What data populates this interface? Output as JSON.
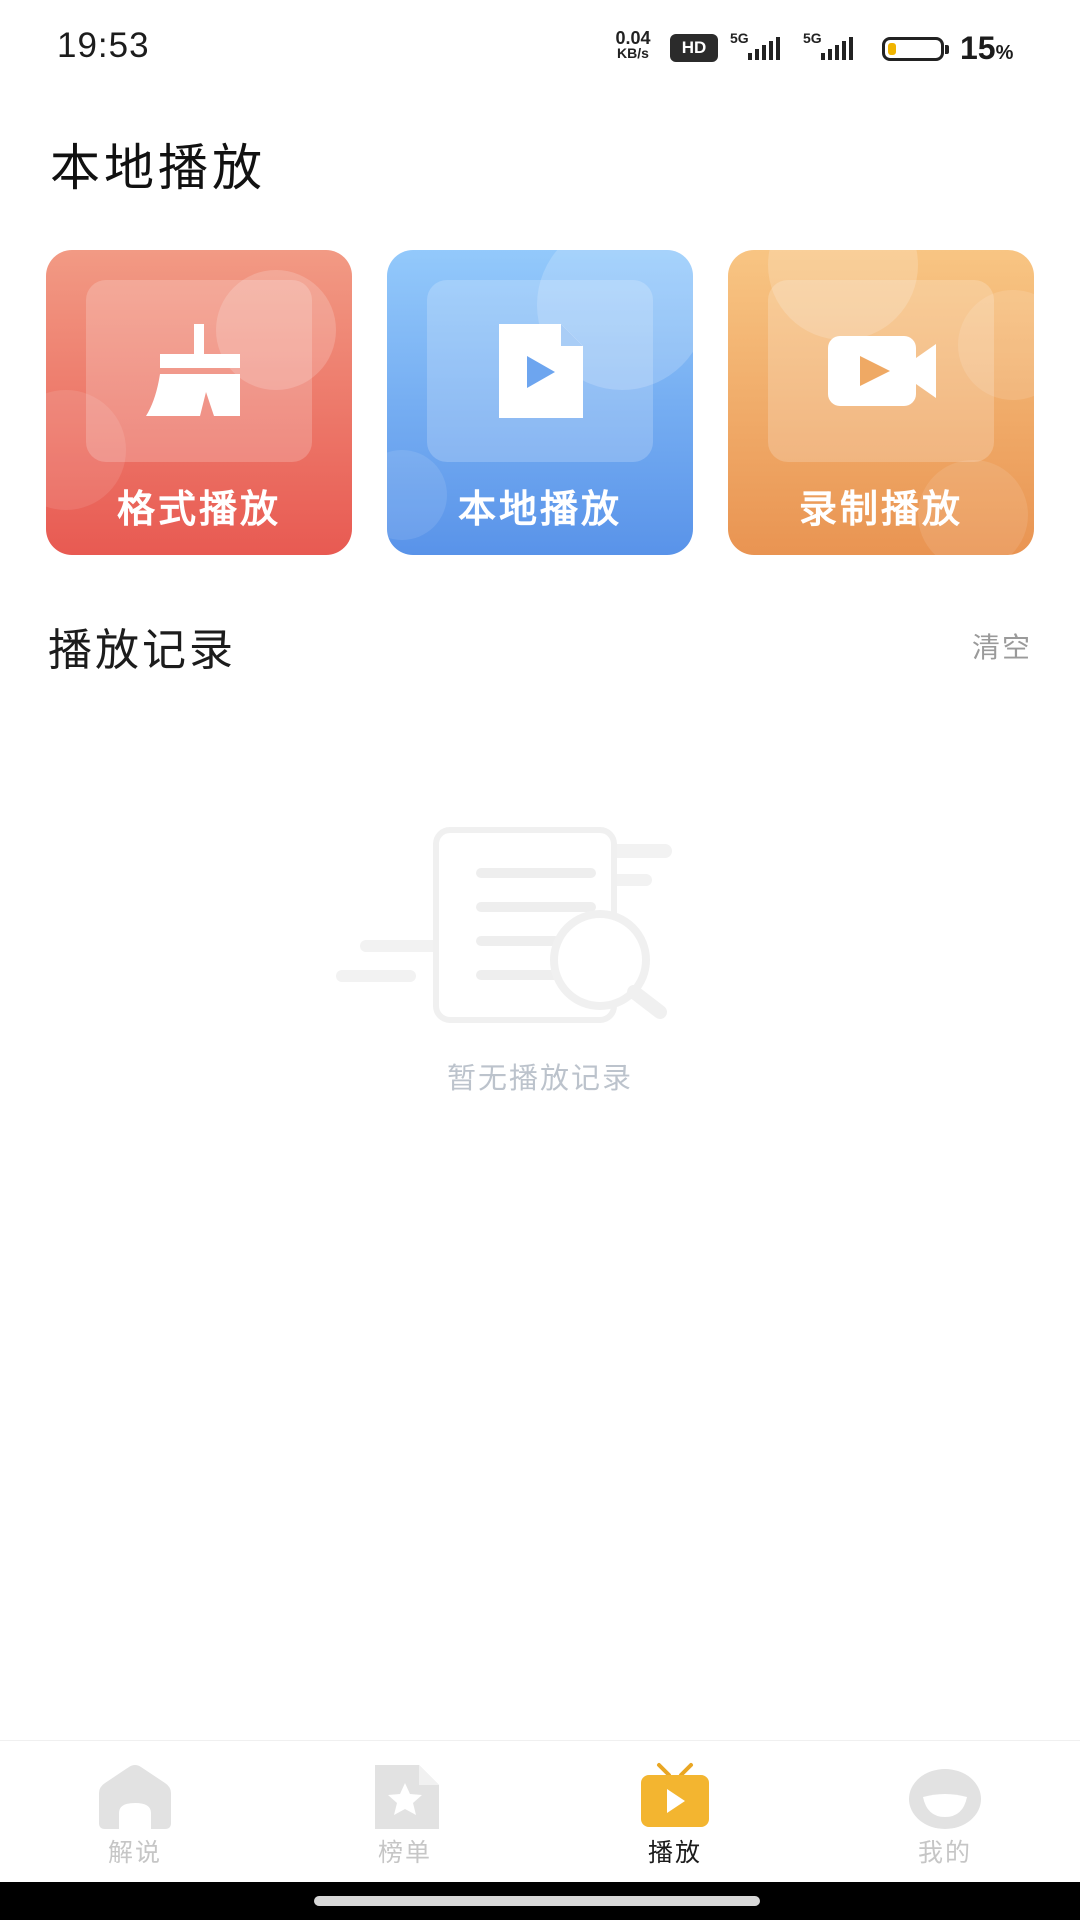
{
  "status_bar": {
    "time": "19:53",
    "net_speed_value": "0.04",
    "net_speed_unit": "KB/s",
    "hd_label": "HD",
    "signal_1_label": "5G",
    "signal_2_label": "5G",
    "battery_percent": "15",
    "battery_percent_sign": "%",
    "battery_level": 0.15,
    "battery_color": "#f0b400"
  },
  "page_title": "本地播放",
  "cards": [
    {
      "label": "格式播放",
      "icon": "broom-icon",
      "color_top": "#f29a84",
      "color_bottom": "#e85a52"
    },
    {
      "label": "本地播放",
      "icon": "video-file-icon",
      "color_top": "#93c9fb",
      "color_bottom": "#5993e9"
    },
    {
      "label": "录制播放",
      "icon": "video-camera-icon",
      "color_top": "#f8c583",
      "color_bottom": "#e99452"
    }
  ],
  "history": {
    "title": "播放记录",
    "clear_label": "清空",
    "empty_text": "暂无播放记录",
    "empty_icon": "empty-document-search-icon"
  },
  "tabbar": {
    "active_index": 2,
    "active_color": "#f3b530",
    "inactive_color": "#e0e0e0",
    "tabs": [
      {
        "label": "解说",
        "icon": "home-icon"
      },
      {
        "label": "榜单",
        "icon": "star-document-icon"
      },
      {
        "label": "播放",
        "icon": "tv-play-icon"
      },
      {
        "label": "我的",
        "icon": "profile-face-icon"
      }
    ]
  }
}
